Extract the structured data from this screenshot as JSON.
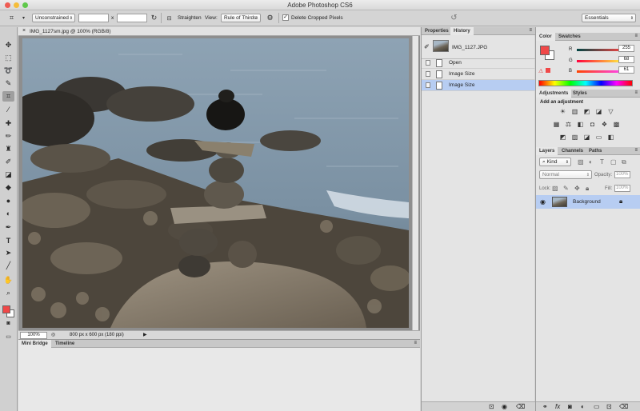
{
  "app_title": "Adobe Photoshop CS6",
  "options_bar": {
    "ratio_preset": "Unconstrained",
    "width_value": "",
    "times": "x",
    "height_value": "",
    "straighten": "Straighten",
    "view_label": "View:",
    "view_value": "Rule of Thirds",
    "delete_cropped": "Delete Cropped Pixels",
    "delete_cropped_checked": true,
    "workspace": "Essentials"
  },
  "document": {
    "tab_title": "IMG_1127sm.jpg @ 100% (RGB/8)",
    "zoom": "100%",
    "info": "800 px x 600 px (180 ppi)"
  },
  "bottom_panel": {
    "tabs": [
      "Mini Bridge",
      "Timeline"
    ]
  },
  "history_panel": {
    "tabs": [
      "Properties",
      "History"
    ],
    "snapshot": "IMG_1127.JPG",
    "states": [
      "Open",
      "Image Size",
      "Image Size"
    ]
  },
  "color_panel": {
    "tabs": [
      "Color",
      "Swatches"
    ],
    "r": {
      "label": "R",
      "value": "255"
    },
    "g": {
      "label": "G",
      "value": "68"
    },
    "b": {
      "label": "B",
      "value": "61"
    },
    "fg_color": "#f04848"
  },
  "adjustments_panel": {
    "tabs": [
      "Adjustments",
      "Styles"
    ],
    "heading": "Add an adjustment"
  },
  "layers_panel": {
    "tabs": [
      "Layers",
      "Channels",
      "Paths"
    ],
    "kind": "Kind",
    "blend_mode": "Normal",
    "opacity_label": "Opacity:",
    "opacity_value": "100%",
    "lock_label": "Lock:",
    "fill_label": "Fill:",
    "fill_value": "100%",
    "layer_name": "Background"
  }
}
